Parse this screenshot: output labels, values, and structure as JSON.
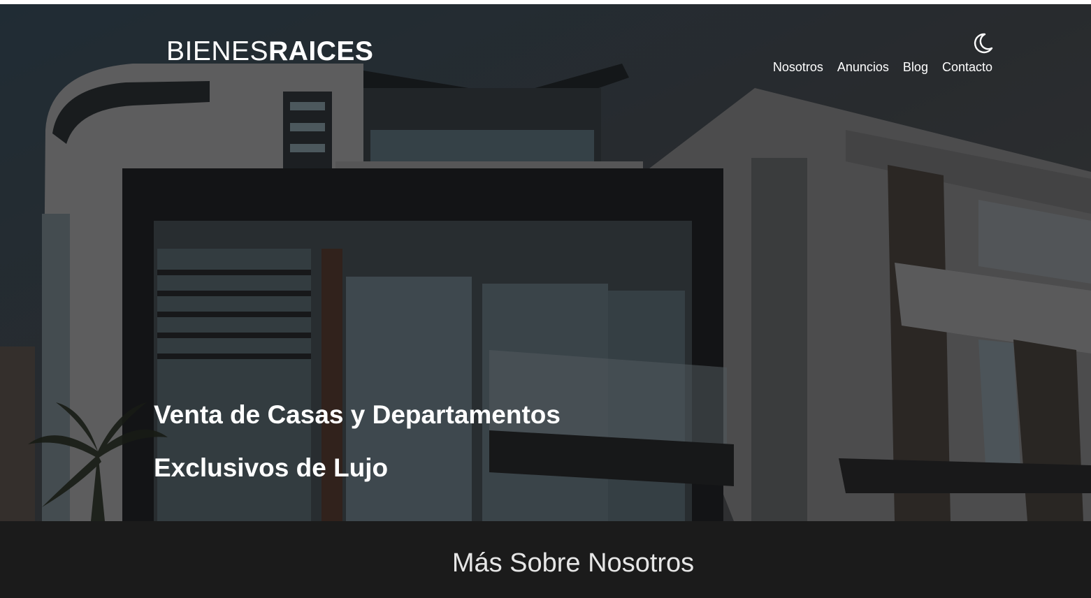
{
  "header": {
    "brand_light": "BIENES",
    "brand_bold": "RAICES",
    "dark_mode_icon": "moon-icon",
    "nav": [
      {
        "label": "Nosotros"
      },
      {
        "label": "Anuncios"
      },
      {
        "label": "Blog"
      },
      {
        "label": "Contacto"
      }
    ]
  },
  "hero": {
    "line1": "Venta de Casas y Departamentos",
    "line2": "Exclusivos de Lujo"
  },
  "about": {
    "heading": "Más Sobre Nosotros"
  },
  "colors": {
    "section_bg": "#1b1b1b",
    "text": "#ffffff"
  }
}
